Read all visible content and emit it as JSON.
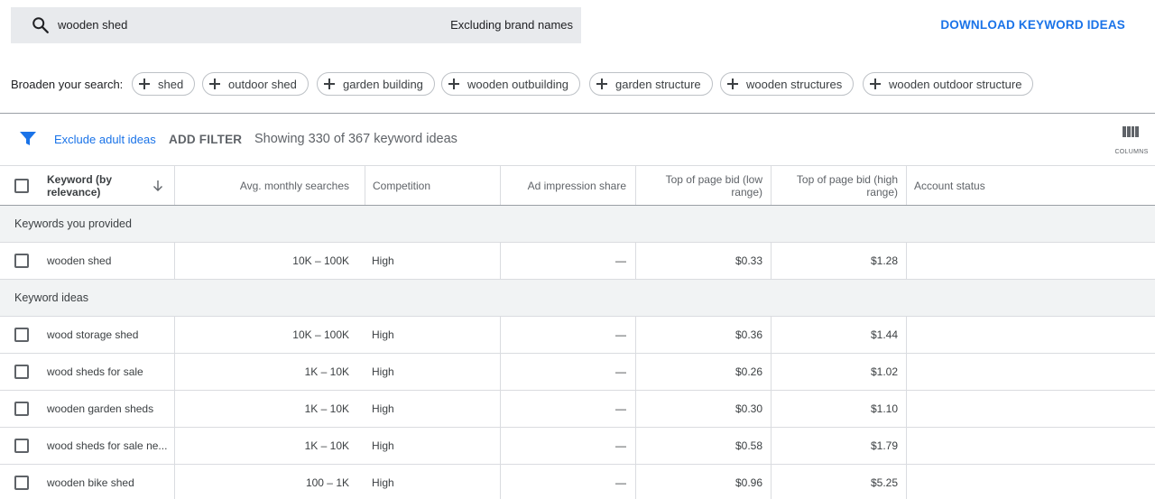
{
  "search": {
    "query": "wooden shed",
    "brand_filter": "Excluding brand names"
  },
  "download_label": "DOWNLOAD KEYWORD IDEAS",
  "broaden": {
    "label": "Broaden your search:",
    "chips": [
      "shed",
      "outdoor shed",
      "garden building",
      "wooden outbuilding",
      "garden structure",
      "wooden structures",
      "wooden outdoor structure"
    ]
  },
  "filterbar": {
    "exclude_adult": "Exclude adult ideas",
    "add_filter": "ADD FILTER",
    "showing": "Showing 330 of 367 keyword ideas",
    "columns_label": "COLUMNS"
  },
  "table": {
    "headers": {
      "keyword": "Keyword (by relevance)",
      "avg": "Avg. monthly searches",
      "competition": "Competition",
      "impression": "Ad impression share",
      "low_bid": "Top of page bid (low range)",
      "high_bid": "Top of page bid (high range)",
      "account_status": "Account status"
    },
    "provided_group": "Keywords you provided",
    "provided_rows": [
      {
        "keyword": "wooden shed",
        "avg": "10K – 100K",
        "competition": "High",
        "impression": "—",
        "low": "$0.33",
        "high": "$1.28",
        "status": ""
      }
    ],
    "ideas_group": "Keyword ideas",
    "idea_rows": [
      {
        "keyword": "wood storage shed",
        "avg": "10K – 100K",
        "competition": "High",
        "impression": "—",
        "low": "$0.36",
        "high": "$1.44",
        "status": ""
      },
      {
        "keyword": "wood sheds for sale",
        "avg": "1K – 10K",
        "competition": "High",
        "impression": "—",
        "low": "$0.26",
        "high": "$1.02",
        "status": ""
      },
      {
        "keyword": "wooden garden sheds",
        "avg": "1K – 10K",
        "competition": "High",
        "impression": "—",
        "low": "$0.30",
        "high": "$1.10",
        "status": ""
      },
      {
        "keyword": "wood sheds for sale ne...",
        "avg": "1K – 10K",
        "competition": "High",
        "impression": "—",
        "low": "$0.58",
        "high": "$1.79",
        "status": ""
      },
      {
        "keyword": "wooden bike shed",
        "avg": "100 – 1K",
        "competition": "High",
        "impression": "—",
        "low": "$0.96",
        "high": "$5.25",
        "status": ""
      }
    ]
  },
  "colors": {
    "accent": "#1a73e8",
    "search_bg": "#e8eaed",
    "group_bg": "#f1f3f4"
  },
  "icons": {
    "search": "search-icon",
    "filter": "filter-icon",
    "columns": "columns-icon",
    "sort": "arrow-down-icon",
    "chip": "plus-icon"
  }
}
